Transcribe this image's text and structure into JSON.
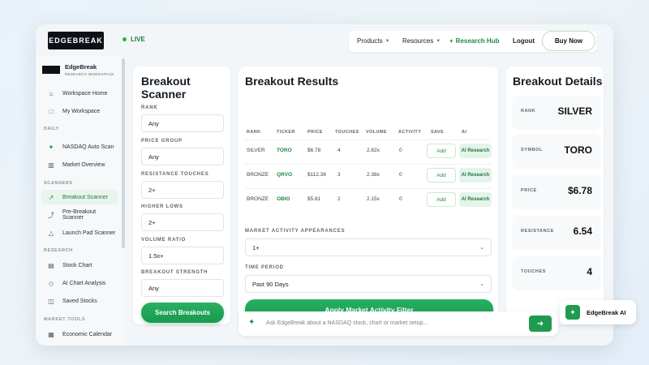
{
  "header": {
    "logo_text": "EDGEBREAK",
    "live_label": "LIVE",
    "nav": {
      "products": "Products",
      "resources": "Resources",
      "research_hub": "Research Hub",
      "logout": "Logout",
      "buy_now": "Buy Now"
    }
  },
  "sidebar": {
    "workspace_title": "EdgeBreak",
    "workspace_subtitle": "RESEARCH WORKSPACE",
    "items_top": [
      {
        "label": "Workspace Home",
        "icon": "home-icon"
      },
      {
        "label": "My Workspace",
        "icon": "square-icon"
      }
    ],
    "section_daily": "DAILY",
    "items_daily": [
      {
        "label": "NASDAQ Auto Scan",
        "icon": "sparkle-icon"
      },
      {
        "label": "Market Overview",
        "icon": "book-icon"
      }
    ],
    "section_scanners": "SCANNERS",
    "items_scanners": [
      {
        "label": "Breakout Scanner",
        "icon": "arrow-up-right-icon"
      },
      {
        "label": "Pre-Breakout Scanner",
        "icon": "trend-icon"
      },
      {
        "label": "Launch Pad Scanner",
        "icon": "rocket-icon"
      }
    ],
    "section_research": "RESEARCH",
    "items_research": [
      {
        "label": "Stock Chart",
        "icon": "chart-icon"
      },
      {
        "label": "AI Chart Analysis",
        "icon": "diamond-icon"
      },
      {
        "label": "Saved Stocks",
        "icon": "bookmark-icon"
      }
    ],
    "section_market_tools": "MARKET TOOLS",
    "items_market_tools": [
      {
        "label": "Economic Calendar",
        "icon": "calendar-icon"
      }
    ]
  },
  "scanner": {
    "title_line1": "Breakout",
    "title_line2": "Scanner",
    "fields": [
      {
        "label": "RANK",
        "value": "Any"
      },
      {
        "label": "PRICE GROUP",
        "value": "Any"
      },
      {
        "label": "RESISTANCE TOUCHES",
        "value": "2+"
      },
      {
        "label": "HIGHER LOWS",
        "value": "2+"
      },
      {
        "label": "VOLUME RATIO",
        "value": "1.5x+"
      },
      {
        "label": "BREAKOUT STRENGTH",
        "value": "Any"
      }
    ],
    "search_button": "Search Breakouts"
  },
  "results": {
    "title": "Breakout Results",
    "columns": [
      "RANK",
      "TICKER",
      "PRICE",
      "TOUCHES",
      "VOLUME",
      "ACTIVITY",
      "SAVE",
      "AI"
    ],
    "rows": [
      {
        "rank": "SILVER",
        "ticker": "TORO",
        "price": "$6.78",
        "touches": "4",
        "volume": "2.82x",
        "activity": "0",
        "save": "Add",
        "ai": "AI Research"
      },
      {
        "rank": "BRONZE",
        "ticker": "QRVO",
        "price": "$112.36",
        "touches": "3",
        "volume": "2.38x",
        "activity": "0",
        "save": "Add",
        "ai": "AI Research"
      },
      {
        "rank": "BRONZE",
        "ticker": "OBIO",
        "price": "$5.81",
        "touches": "2",
        "volume": "2.15x",
        "activity": "0",
        "save": "Add",
        "ai": "AI Research"
      }
    ],
    "market_activity_label": "MARKET ACTIVITY APPEARANCES",
    "market_activity_value": "1+",
    "time_period_label": "TIME PERIOD",
    "time_period_value": "Past 90 Days",
    "apply_button": "Apply Market Activity Filter"
  },
  "details": {
    "title": "Breakout Details",
    "cards": [
      {
        "label": "RANK",
        "value": "SILVER"
      },
      {
        "label": "SYMBOL",
        "value": "TORO"
      },
      {
        "label": "PRICE",
        "value": "$6.78"
      },
      {
        "label": "RESISTANCE",
        "value": "6.54"
      },
      {
        "label": "TOUCHES",
        "value": "4"
      }
    ]
  },
  "ask": {
    "placeholder": "Ask EdgeBreak about a NASDAQ stock, chart or market setup...",
    "send_icon": "arrow-right-icon"
  },
  "ai_chip": {
    "label": "EdgeBreak AI"
  },
  "colors": {
    "accent": "#1f9a4f",
    "background": "#f3f6f8"
  }
}
